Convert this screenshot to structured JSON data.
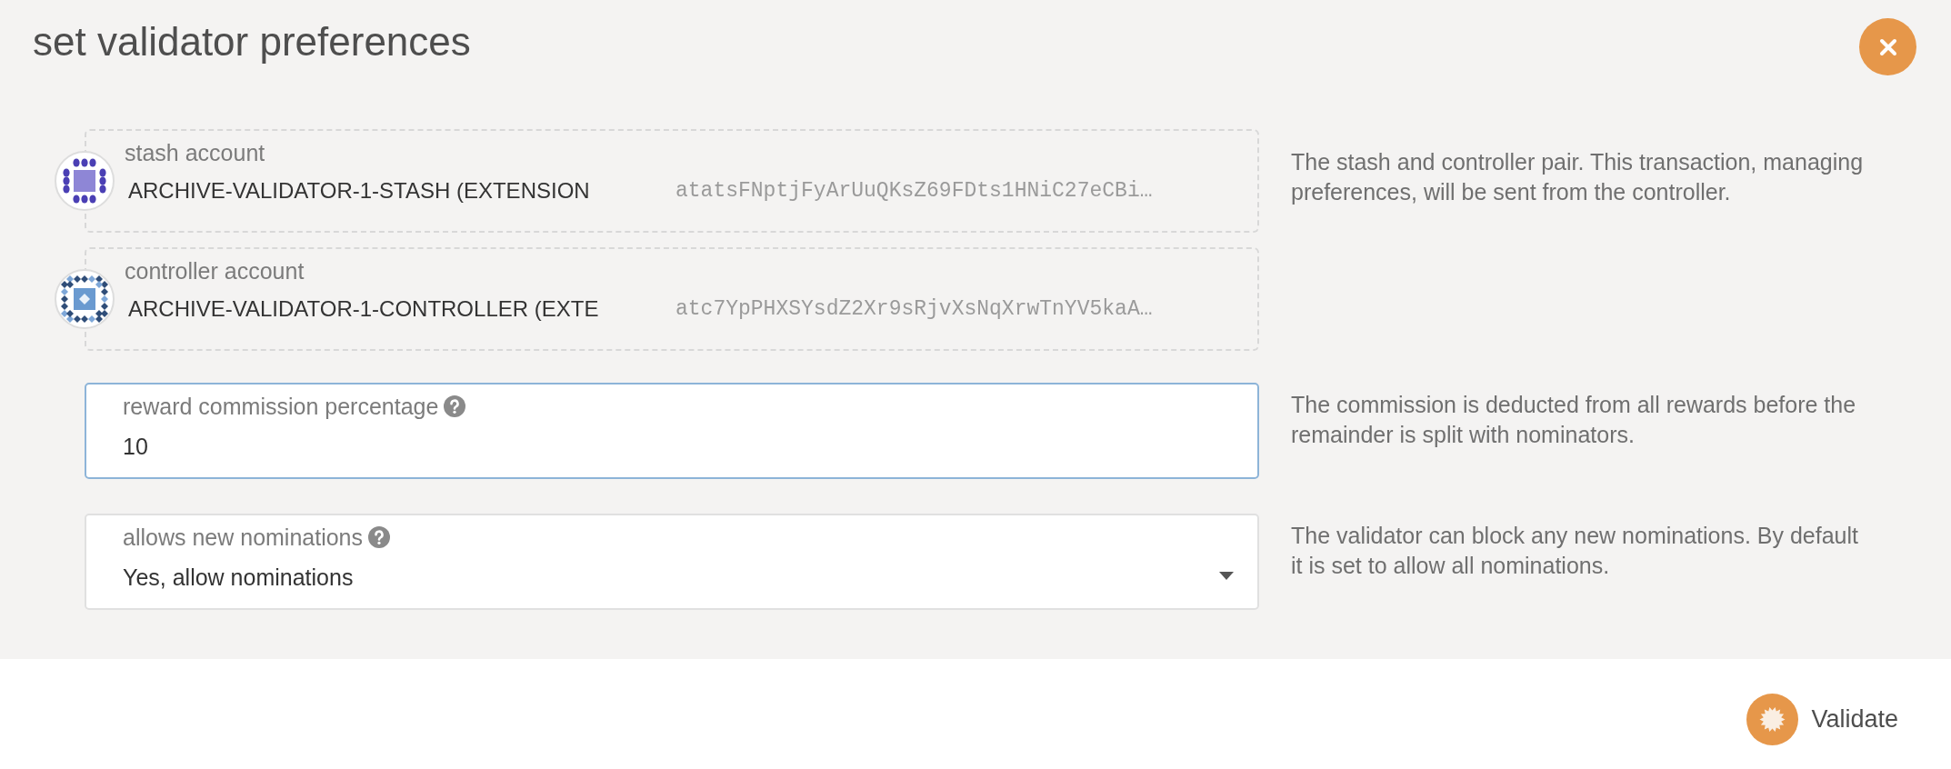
{
  "title": "set validator preferences",
  "accounts": [
    {
      "label": "stash account",
      "name": "ARCHIVE-VALIDATOR-1-STASH (EXTENSION",
      "address": "atatsFNptjFyArUuQKsZ69FDts1HNiC27eCBi…",
      "kind": "dots"
    },
    {
      "label": "controller account",
      "name": "ARCHIVE-VALIDATOR-1-CONTROLLER (EXTE",
      "address": "atc7YpPHXSYsdZ2Xr9sRjvXsNqXrwTnYV5kaA…",
      "kind": "diamonds"
    }
  ],
  "accounts_help": "The stash and controller pair. This transaction, managing preferences, will be sent from the controller.",
  "fields": [
    {
      "kind": "input",
      "label": "reward commission percentage",
      "value": "10",
      "focused": true,
      "help": "The commission is deducted from all rewards before the remainder is split with nominators."
    },
    {
      "kind": "dropdown",
      "label": "allows new nominations",
      "value": "Yes, allow nominations",
      "focused": false,
      "help": "The validator can block any new nominations. By default it is set to allow all nominations."
    }
  ],
  "validate_button": "Validate"
}
